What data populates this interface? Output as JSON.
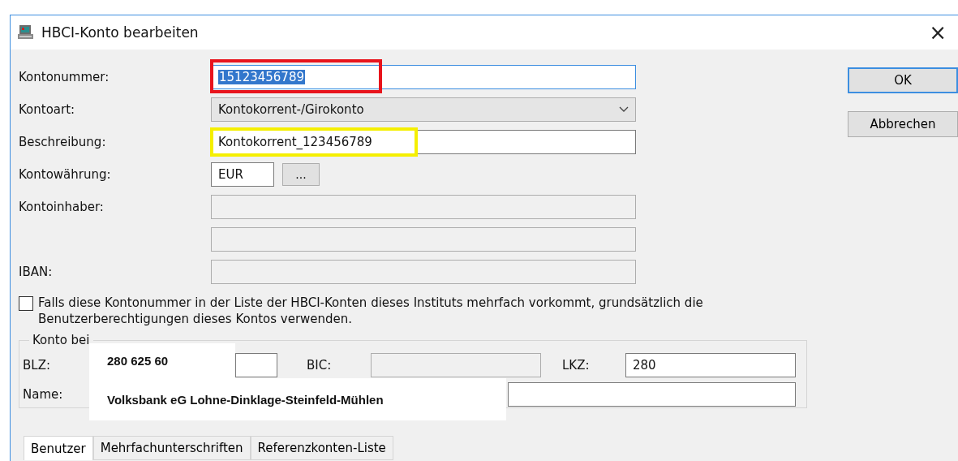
{
  "window": {
    "title": "HBCI-Konto bearbeiten",
    "close": "×"
  },
  "fields": [
    {
      "kind": "text",
      "label": "Kontonummer:",
      "value": "15123456789",
      "focused": true,
      "text_selected": true,
      "color": "#e8141c"
    },
    {
      "kind": "combo",
      "label": "Kontoart:",
      "value": "Kontokorrent-/Girokonto"
    },
    {
      "kind": "text",
      "label": "Beschreibung:",
      "value": "Kontokorrent_123456789",
      "focused": false,
      "text_selected": false,
      "color": "#f5ef00"
    },
    {
      "kind": "currency",
      "label": "Kontowährung:",
      "value": "EUR",
      "button": "..."
    },
    {
      "kind": "readonly",
      "label": "Kontoinhaber:"
    },
    {
      "kind": "readonly"
    },
    {
      "kind": "readonly",
      "label": "IBAN:"
    }
  ],
  "checkbox": {
    "checked": false,
    "label": "Falls diese Kontonummer in der Liste der HBCI-Konten dieses Instituts mehrfach vorkommt, grundsätzlich die Benutzerberechtigungen dieses Kontos verwenden."
  },
  "buttons": [
    {
      "label": "OK",
      "default": true
    },
    {
      "label": "Abbrechen",
      "default": false
    }
  ],
  "bank_group": {
    "title": "Konto bei",
    "blz_label": "BLZ:",
    "bic_label": "BIC:",
    "lkz_label": "LKZ:",
    "lkz_value": "280",
    "name_label": "Name:"
  },
  "overlay_notes": [
    "280 625 60",
    "Volksbank eG Lohne-Dinklage-Steinfeld-Mühlen"
  ],
  "tabs": [
    {
      "label": "Benutzer",
      "selected": true
    },
    {
      "label": "Mehrfachunterschriften",
      "selected": false
    },
    {
      "label": "Referenzkonten-Liste",
      "selected": false
    }
  ]
}
